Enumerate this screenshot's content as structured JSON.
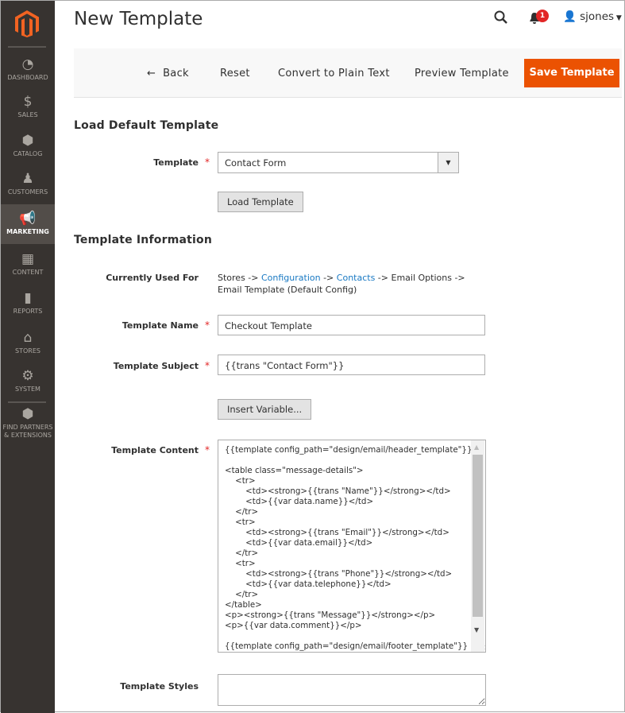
{
  "sidebar": {
    "items": [
      {
        "label": "DASHBOARD",
        "icon": "dashboard-icon"
      },
      {
        "label": "SALES",
        "icon": "dollar-icon"
      },
      {
        "label": "CATALOG",
        "icon": "box-icon"
      },
      {
        "label": "CUSTOMERS",
        "icon": "person-icon"
      },
      {
        "label": "MARKETING",
        "icon": "megaphone-icon",
        "active": true
      },
      {
        "label": "CONTENT",
        "icon": "layout-icon"
      },
      {
        "label": "REPORTS",
        "icon": "bar-chart-icon"
      },
      {
        "label": "STORES",
        "icon": "store-icon"
      },
      {
        "label": "SYSTEM",
        "icon": "gear-icon"
      },
      {
        "label": "FIND PARTNERS & EXTENSIONS",
        "icon": "blocks-icon"
      }
    ]
  },
  "header": {
    "title": "New Template",
    "notifications": "1",
    "user": "sjones"
  },
  "actions": {
    "back": "Back",
    "reset": "Reset",
    "convert": "Convert to Plain Text",
    "preview": "Preview Template",
    "save": "Save Template"
  },
  "load_section": {
    "title": "Load Default Template",
    "template_label": "Template",
    "template_value": "Contact Form",
    "load_button": "Load Template"
  },
  "info_section": {
    "title": "Template Information",
    "used_for_label": "Currently Used For",
    "used_for": {
      "p1": "Stores -> ",
      "link1": "Configuration",
      "p2": " -> ",
      "link2": "Contacts",
      "p3": " -> Email Options -> Email Template  (Default Config)"
    },
    "name_label": "Template Name",
    "name_value": "Checkout Template",
    "subject_label": "Template Subject",
    "subject_value": "{{trans \"Contact Form\"}}",
    "insert_button": "Insert Variable...",
    "content_label": "Template Content",
    "content_value": "{{template config_path=\"design/email/header_template\"}}\n\n<table class=\"message-details\">\n    <tr>\n        <td><strong>{{trans \"Name\"}}</strong></td>\n        <td>{{var data.name}}</td>\n    </tr>\n    <tr>\n        <td><strong>{{trans \"Email\"}}</strong></td>\n        <td>{{var data.email}}</td>\n    </tr>\n    <tr>\n        <td><strong>{{trans \"Phone\"}}</strong></td>\n        <td>{{var data.telephone}}</td>\n    </tr>\n</table>\n<p><strong>{{trans \"Message\"}}</strong></p>\n<p>{{var data.comment}}</p>\n\n{{template config_path=\"design/email/footer_template\"}}",
    "styles_label": "Template Styles",
    "styles_value": ""
  },
  "required_mark": "*"
}
